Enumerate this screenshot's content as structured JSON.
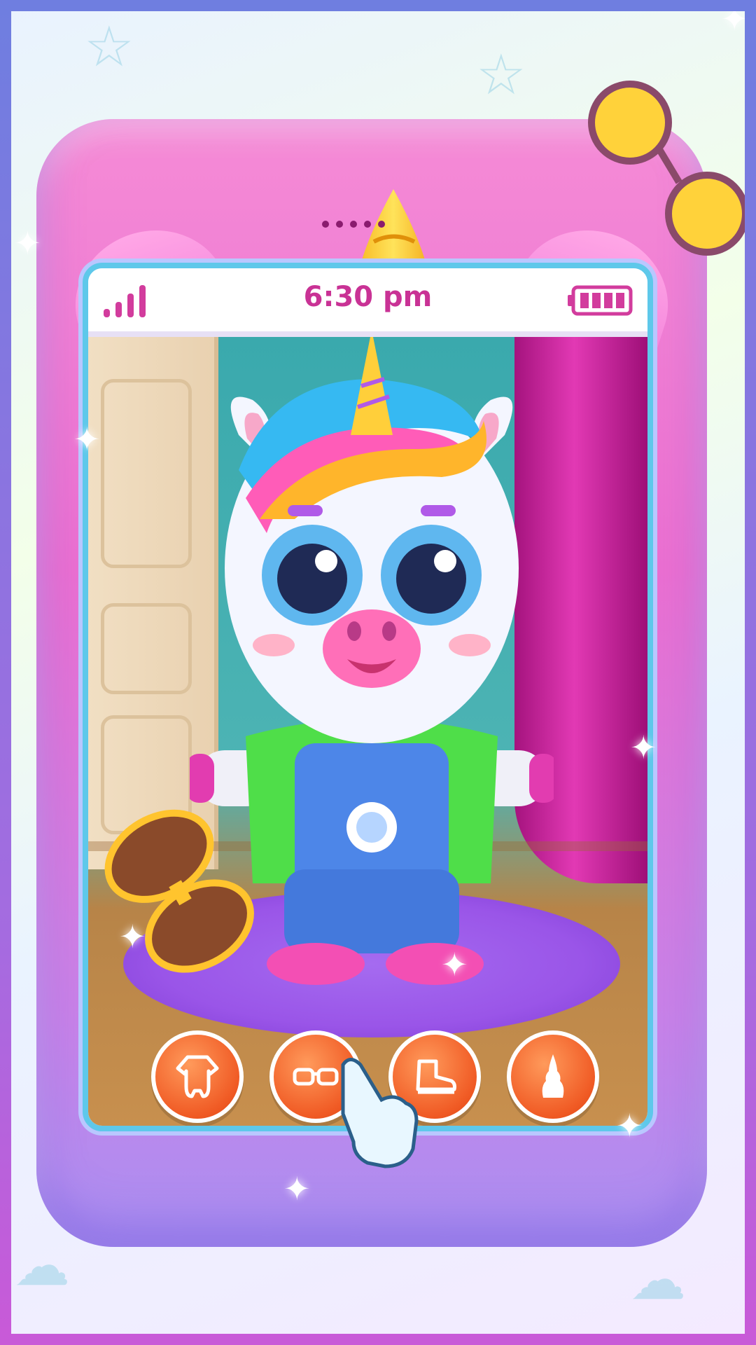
{
  "status_bar": {
    "time": "6:30 pm",
    "signal_bars": 4,
    "battery_level": 1.0
  },
  "phone": {
    "style": "pink-unicorn-toy-phone",
    "icons": {
      "horn": "unicorn-horn-icon",
      "eyes": "sleeping-eyelash-icon",
      "speaker": "speaker-dots-icon"
    }
  },
  "scene": {
    "character": "baby-unicorn",
    "outfit": [
      "green-jacket",
      "blue-overalls",
      "pink-sneakers"
    ]
  },
  "toolbar": {
    "buttons": [
      {
        "icon": "onesie-icon"
      },
      {
        "icon": "glasses-icon"
      },
      {
        "icon": "shoe-icon"
      },
      {
        "icon": "unicorn-horn-icon"
      }
    ]
  },
  "colors": {
    "phone_pink": "#f07ad8",
    "screen_border": "#5ec8ea",
    "clock_text": "#c93295",
    "button_orange": "#f05a24"
  }
}
